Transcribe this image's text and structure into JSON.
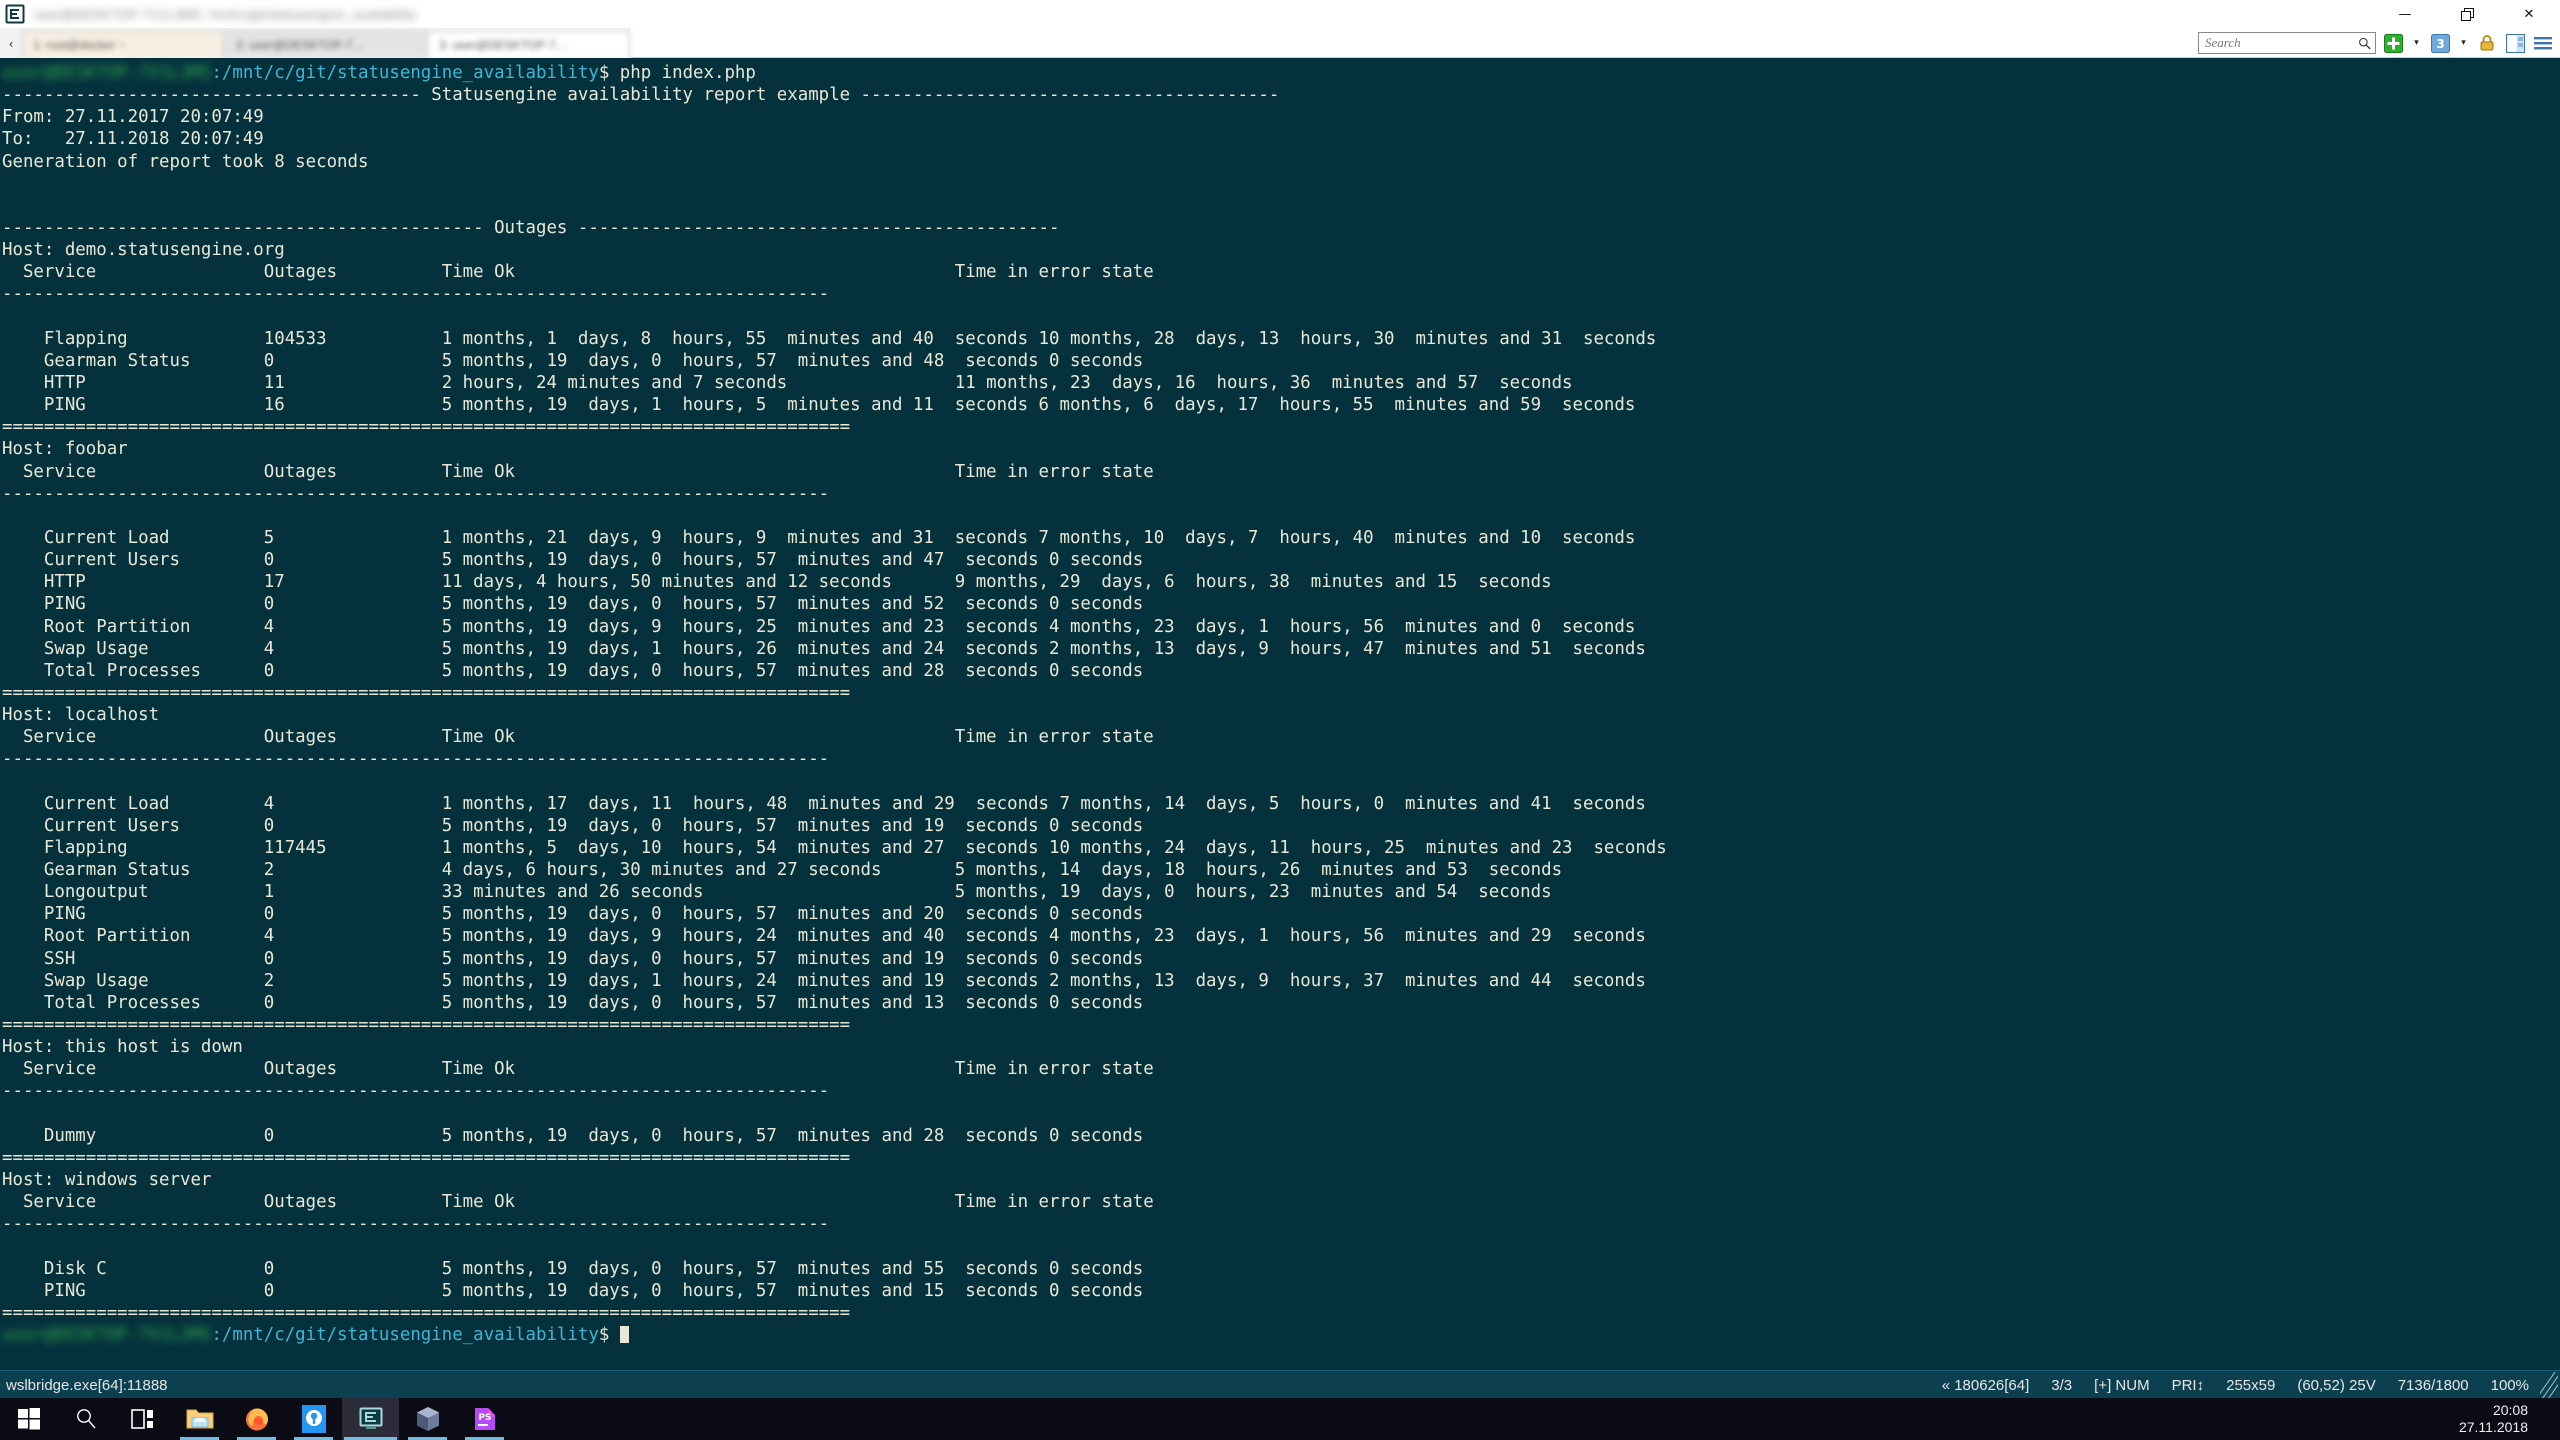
{
  "window": {
    "title_redacted": "user@DESKTOP-7V1L3M5: /mnt/c/git/statusengine_availability",
    "icon": "conemu-icon",
    "controls": {
      "minimize": "—",
      "restore": "❐",
      "close": "✕"
    }
  },
  "tabs": {
    "scroll_left": "‹",
    "items": [
      {
        "label": "1: root@docker ~",
        "active": false
      },
      {
        "label": "2: user@DESKTOP-7…",
        "active": true
      },
      {
        "label": "3: user@DESKTOP-7…",
        "active": false
      }
    ]
  },
  "toolbar": {
    "search_placeholder": "Search",
    "search_value": "",
    "search_icon": "magnifier-icon",
    "new_console_icon": "green-plus-icon",
    "new_console_caret": "▾",
    "console_count_icon": "console-3-icon",
    "console_caret": "▾",
    "lock_icon": "padlock-icon",
    "split_icon": "split-pane-icon",
    "menu_icon": "hamburger-menu-icon"
  },
  "terminal": {
    "prompt_user_redacted": "user@DESKTOP-7V1L3M5",
    "prompt_path": ":/mnt/c/git/statusengine_availability",
    "prompt_sigil": "$ ",
    "command": "php index.php",
    "report_title_line": "---------------------------------------- Statusengine availability report example ----------------------------------------",
    "from_line": "From: 27.11.2017 20:07:49",
    "to_line": "To:   27.11.2018 20:07:49",
    "generation_line": "Generation of report took 8 seconds",
    "outages_banner": "---------------------------------------------- Outages ----------------------------------------------",
    "columns": {
      "service": "Service",
      "outages": "Outages",
      "time_ok": "Time Ok",
      "time_error": "Time in error state"
    },
    "dash_rule": "-------------------------------------------------------------------------------",
    "equals_rule": "=================================================================================",
    "final_prompt_cursor": "block-cursor"
  },
  "report": {
    "hosts": [
      {
        "host_label": "Host: demo.statusengine.org",
        "services": [
          {
            "service": "Flapping",
            "outages": "104533",
            "time_ok": "1 months, 1  days, 8  hours, 55  minutes and 40  seconds",
            "time_error": "10 months, 28  days, 13  hours, 30  minutes and 31  seconds"
          },
          {
            "service": "Gearman Status",
            "outages": "0",
            "time_ok": "5 months, 19  days, 0  hours, 57  minutes and 48  seconds",
            "time_error": "0 seconds"
          },
          {
            "service": "HTTP",
            "outages": "11",
            "time_ok": "2 hours, 24 minutes and 7 seconds",
            "time_error": "11 months, 23  days, 16  hours, 36  minutes and 57  seconds"
          },
          {
            "service": "PING",
            "outages": "16",
            "time_ok": "5 months, 19  days, 1  hours, 5  minutes and 11  seconds",
            "time_error": "6 months, 6  days, 17  hours, 55  minutes and 59  seconds"
          }
        ]
      },
      {
        "host_label": "Host: foobar",
        "services": [
          {
            "service": "Current Load",
            "outages": "5",
            "time_ok": "1 months, 21  days, 9  hours, 9  minutes and 31  seconds",
            "time_error": "7 months, 10  days, 7  hours, 40  minutes and 10  seconds"
          },
          {
            "service": "Current Users",
            "outages": "0",
            "time_ok": "5 months, 19  days, 0  hours, 57  minutes and 47  seconds",
            "time_error": "0 seconds"
          },
          {
            "service": "HTTP",
            "outages": "17",
            "time_ok": "11 days, 4 hours, 50 minutes and 12 seconds",
            "time_error": "9 months, 29  days, 6  hours, 38  minutes and 15  seconds"
          },
          {
            "service": "PING",
            "outages": "0",
            "time_ok": "5 months, 19  days, 0  hours, 57  minutes and 52  seconds",
            "time_error": "0 seconds"
          },
          {
            "service": "Root Partition",
            "outages": "4",
            "time_ok": "5 months, 19  days, 9  hours, 25  minutes and 23  seconds",
            "time_error": "4 months, 23  days, 1  hours, 56  minutes and 0  seconds"
          },
          {
            "service": "Swap Usage",
            "outages": "4",
            "time_ok": "5 months, 19  days, 1  hours, 26  minutes and 24  seconds",
            "time_error": "2 months, 13  days, 9  hours, 47  minutes and 51  seconds"
          },
          {
            "service": "Total Processes",
            "outages": "0",
            "time_ok": "5 months, 19  days, 0  hours, 57  minutes and 28  seconds",
            "time_error": "0 seconds"
          }
        ]
      },
      {
        "host_label": "Host: localhost",
        "services": [
          {
            "service": "Current Load",
            "outages": "4",
            "time_ok": "1 months, 17  days, 11  hours, 48  minutes and 29  seconds",
            "time_error": "7 months, 14  days, 5  hours, 0  minutes and 41  seconds"
          },
          {
            "service": "Current Users",
            "outages": "0",
            "time_ok": "5 months, 19  days, 0  hours, 57  minutes and 19  seconds",
            "time_error": "0 seconds"
          },
          {
            "service": "Flapping",
            "outages": "117445",
            "time_ok": "1 months, 5  days, 10  hours, 54  minutes and 27  seconds",
            "time_error": "10 months, 24  days, 11  hours, 25  minutes and 23  seconds"
          },
          {
            "service": "Gearman Status",
            "outages": "2",
            "time_ok": "4 days, 6 hours, 30 minutes and 27 seconds",
            "time_error": "5 months, 14  days, 18  hours, 26  minutes and 53  seconds"
          },
          {
            "service": "Longoutput",
            "outages": "1",
            "time_ok": "33 minutes and 26 seconds",
            "time_error": "5 months, 19  days, 0  hours, 23  minutes and 54  seconds"
          },
          {
            "service": "PING",
            "outages": "0",
            "time_ok": "5 months, 19  days, 0  hours, 57  minutes and 20  seconds",
            "time_error": "0 seconds"
          },
          {
            "service": "Root Partition",
            "outages": "4",
            "time_ok": "5 months, 19  days, 9  hours, 24  minutes and 40  seconds",
            "time_error": "4 months, 23  days, 1  hours, 56  minutes and 29  seconds"
          },
          {
            "service": "SSH",
            "outages": "0",
            "time_ok": "5 months, 19  days, 0  hours, 57  minutes and 19  seconds",
            "time_error": "0 seconds"
          },
          {
            "service": "Swap Usage",
            "outages": "2",
            "time_ok": "5 months, 19  days, 1  hours, 24  minutes and 19  seconds",
            "time_error": "2 months, 13  days, 9  hours, 37  minutes and 44  seconds"
          },
          {
            "service": "Total Processes",
            "outages": "0",
            "time_ok": "5 months, 19  days, 0  hours, 57  minutes and 13  seconds",
            "time_error": "0 seconds"
          }
        ]
      },
      {
        "host_label": "Host: this host is down",
        "services": [
          {
            "service": "Dummy",
            "outages": "0",
            "time_ok": "5 months, 19  days, 0  hours, 57  minutes and 28  seconds",
            "time_error": "0 seconds"
          }
        ]
      },
      {
        "host_label": "Host: windows server",
        "services": [
          {
            "service": "Disk C",
            "outages": "0",
            "time_ok": "5 months, 19  days, 0  hours, 57  minutes and 55  seconds",
            "time_error": "0 seconds"
          },
          {
            "service": "PING",
            "outages": "0",
            "time_ok": "5 months, 19  days, 0  hours, 57  minutes and 15  seconds",
            "time_error": "0 seconds"
          }
        ]
      }
    ]
  },
  "statusbar": {
    "process": "wslbridge.exe[64]:11888",
    "cells": [
      "« 180626[64]",
      "3/3",
      "[+] NUM",
      "PRI↕",
      "255x59",
      "(60,52) 25V",
      "7136/1800",
      "100%"
    ]
  },
  "taskbar": {
    "items": [
      {
        "name": "start-button",
        "icon": "windows-logo-icon",
        "state": "idle"
      },
      {
        "name": "search-button",
        "icon": "magnifier-icon",
        "state": "idle"
      },
      {
        "name": "task-view-button",
        "icon": "task-view-icon",
        "state": "idle"
      },
      {
        "name": "file-explorer",
        "icon": "folder-icon",
        "state": "open"
      },
      {
        "name": "firefox",
        "icon": "firefox-icon",
        "state": "open"
      },
      {
        "name": "keepass",
        "icon": "keepass-icon",
        "state": "open"
      },
      {
        "name": "conemu",
        "icon": "conemu-icon",
        "state": "active"
      },
      {
        "name": "virtualbox",
        "icon": "virtualbox-icon",
        "state": "open"
      },
      {
        "name": "phpstorm",
        "icon": "phpstorm-icon",
        "state": "open"
      }
    ],
    "clock_time": "20:08",
    "clock_date": "27.11.2018"
  },
  "colors": {
    "terminal_bg": "#05313c",
    "terminal_fg": "#e8e8d8",
    "prompt_user": "#2fa84f",
    "prompt_path": "#3fb6d6",
    "statusbar_bg": "#0c4050",
    "taskbar_bg": "#0b0b16",
    "accent": "#76b9e0"
  }
}
